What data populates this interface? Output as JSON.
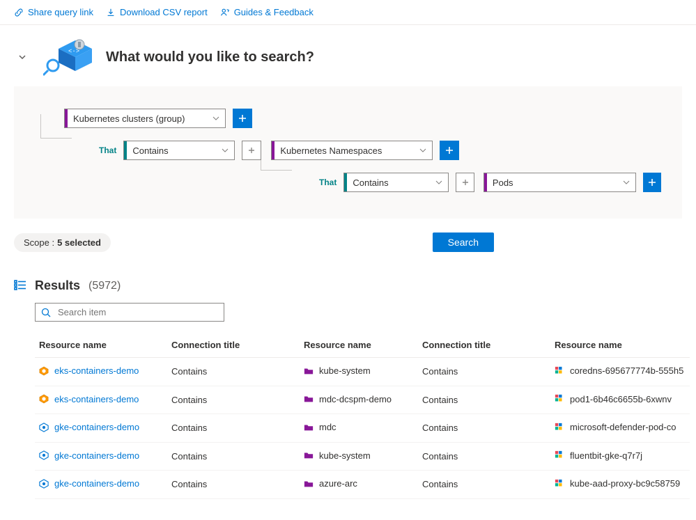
{
  "topbar": {
    "share": "Share query link",
    "download": "Download CSV report",
    "guides": "Guides & Feedback"
  },
  "header": {
    "title": "What would you like to search?"
  },
  "query": {
    "row1": {
      "value": "Kubernetes clusters (group)"
    },
    "row2": {
      "that": "That",
      "op": "Contains",
      "value": "Kubernetes Namespaces"
    },
    "row3": {
      "that": "That",
      "op": "Contains",
      "value": "Pods"
    }
  },
  "scope": {
    "label": "Scope :",
    "selected": "5 selected"
  },
  "buttons": {
    "search": "Search"
  },
  "results": {
    "title": "Results",
    "count": "(5972)",
    "search_placeholder": "Search item",
    "columns": {
      "c1": "Resource name",
      "c2": "Connection title",
      "c3": "Resource name",
      "c4": "Connection title",
      "c5": "Resource name"
    },
    "rows": [
      {
        "r1": "eks-containers-demo",
        "c1": "Contains",
        "r2": "kube-system",
        "c2": "Contains",
        "r3": "coredns-695677774b-555h5",
        "cluster": "eks",
        "ns_color": "#881798"
      },
      {
        "r1": "eks-containers-demo",
        "c1": "Contains",
        "r2": "mdc-dcspm-demo",
        "c2": "Contains",
        "r3": "pod1-6b46c6655b-6xwnv",
        "cluster": "eks",
        "ns_color": "#881798"
      },
      {
        "r1": "gke-containers-demo",
        "c1": "Contains",
        "r2": "mdc",
        "c2": "Contains",
        "r3": "microsoft-defender-pod-co",
        "cluster": "gke",
        "ns_color": "#881798"
      },
      {
        "r1": "gke-containers-demo",
        "c1": "Contains",
        "r2": "kube-system",
        "c2": "Contains",
        "r3": "fluentbit-gke-q7r7j",
        "cluster": "gke",
        "ns_color": "#881798"
      },
      {
        "r1": "gke-containers-demo",
        "c1": "Contains",
        "r2": "azure-arc",
        "c2": "Contains",
        "r3": "kube-aad-proxy-bc9c58759",
        "cluster": "gke",
        "ns_color": "#881798"
      }
    ]
  }
}
